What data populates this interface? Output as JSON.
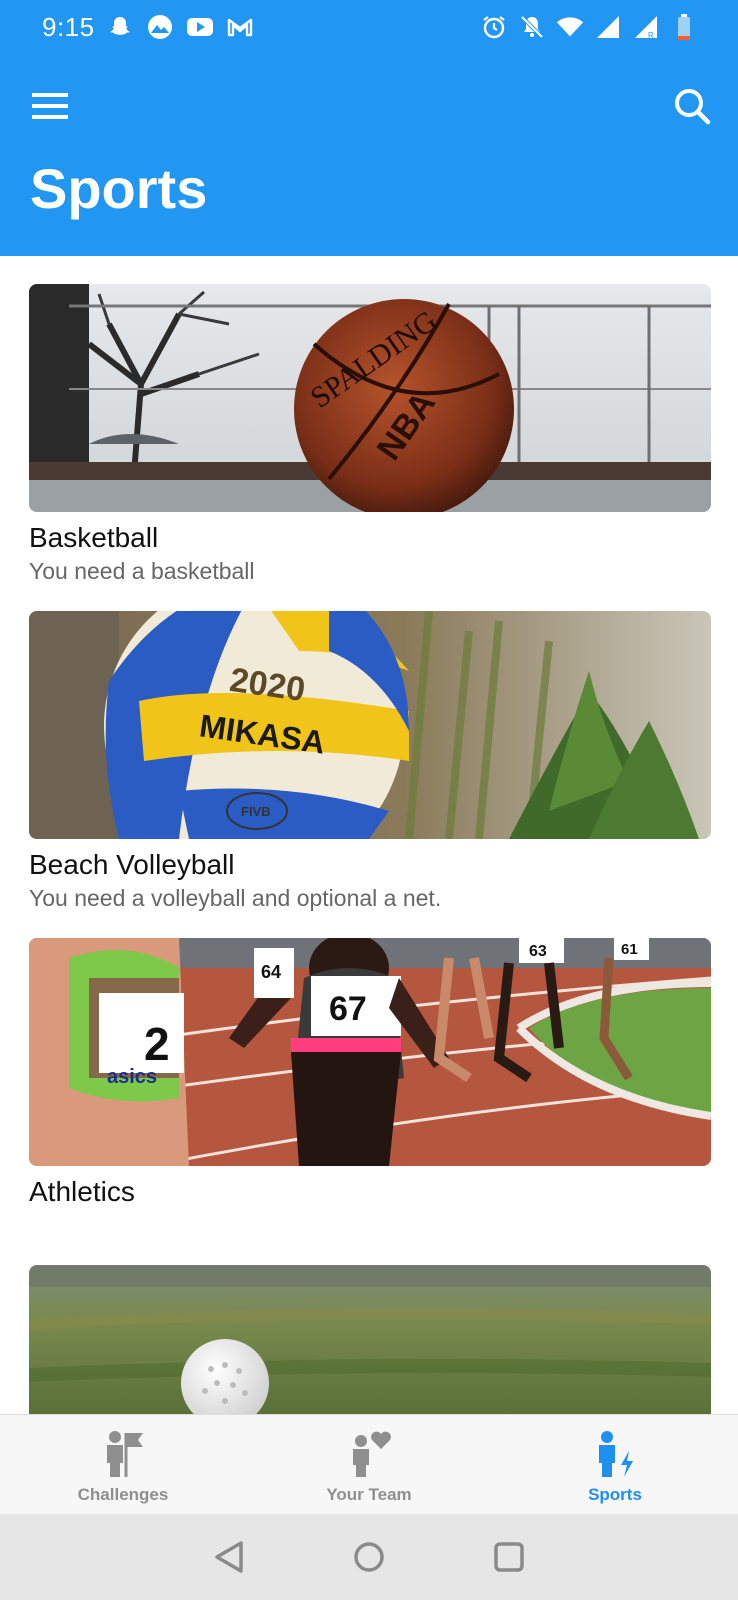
{
  "status_bar": {
    "time": "9:15",
    "left_icons": [
      "snapchat-icon",
      "mountain-app-icon",
      "youtube-icon",
      "gmail-icon"
    ],
    "right_icons": [
      "alarm-icon",
      "notifications-off-icon",
      "wifi-icon",
      "signal-icon",
      "signal-roaming-icon",
      "battery-icon"
    ]
  },
  "app_bar": {
    "title": "Sports",
    "menu_icon": "hamburger-menu-icon",
    "search_icon": "search-icon"
  },
  "sports": [
    {
      "title": "Basketball",
      "subtitle": "You need a basketball",
      "image": "basketball-photo"
    },
    {
      "title": "Beach Volleyball",
      "subtitle": "You need a volleyball and optional a net.",
      "image": "volleyball-photo"
    },
    {
      "title": "Athletics",
      "subtitle": "",
      "image": "athletics-photo"
    },
    {
      "title": "",
      "subtitle": "",
      "image": "golf-photo"
    }
  ],
  "bottom_nav": {
    "items": [
      {
        "label": "Challenges",
        "icon": "challenges-flag-icon",
        "active": false
      },
      {
        "label": "Your Team",
        "icon": "team-heart-icon",
        "active": false
      },
      {
        "label": "Sports",
        "icon": "sports-person-bolt-icon",
        "active": true
      }
    ]
  },
  "system_nav": [
    "back-icon",
    "home-icon",
    "recents-icon"
  ],
  "colors": {
    "primary": "#2196F3",
    "active_nav": "#1F8FF0",
    "inactive_nav": "#8F8F8F",
    "title_text": "#111111",
    "subtitle_text": "#666666"
  }
}
